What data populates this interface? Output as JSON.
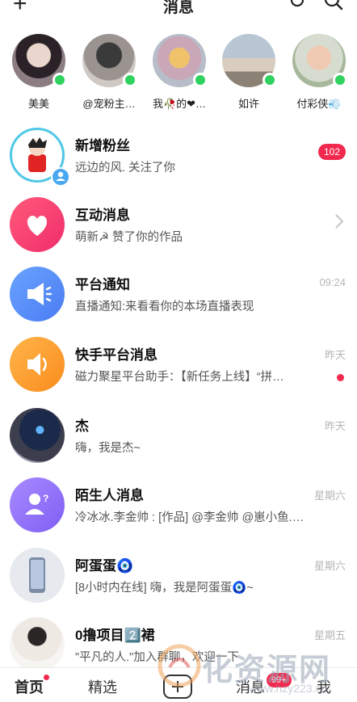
{
  "header": {
    "title": "消息"
  },
  "stories": [
    {
      "name": "美美"
    },
    {
      "name": "@宠粉主…"
    },
    {
      "name": "我🥀的❤…"
    },
    {
      "name": "如许"
    },
    {
      "name": "付彩侠💨"
    }
  ],
  "messages": [
    {
      "title": "新增粉丝",
      "subtitle": "远边的风. 关注了你",
      "badge": "102"
    },
    {
      "title": "互动消息",
      "subtitle": "萌新☭ 赞了你的作品"
    },
    {
      "title": "平台通知",
      "subtitle": "直播通知:来看看你的本场直播表现",
      "time": "09:24"
    },
    {
      "title": "快手平台消息",
      "subtitle": "磁力聚星平台助手：【新任务上线】“拼…",
      "time": "昨天"
    },
    {
      "title": "杰",
      "subtitle": "嗨，我是杰~",
      "time": "昨天"
    },
    {
      "title": "陌生人消息",
      "subtitle": "冷冰冰.李金帅 : [作品] @李金帅 @崽小鱼.…",
      "time": "星期六"
    },
    {
      "title": "阿蛋蛋🧿",
      "subtitle": "[8小时内在线] 嗨，我是阿蛋蛋🧿~",
      "time": "星期六"
    },
    {
      "title": "0撸项目2️⃣裙",
      "subtitle": "\"平凡的人.\"加入群聊，欢迎一下",
      "time": "星期五"
    }
  ],
  "bottom_nav": {
    "home": "首页",
    "featured": "精选",
    "messages": "消息",
    "messages_badge": "99+",
    "me": "我"
  },
  "watermark": {
    "text": "化资源网",
    "url": "www.hzy223.cn"
  },
  "colors": {
    "accent": "#f2294f",
    "online": "#2fd15f"
  }
}
